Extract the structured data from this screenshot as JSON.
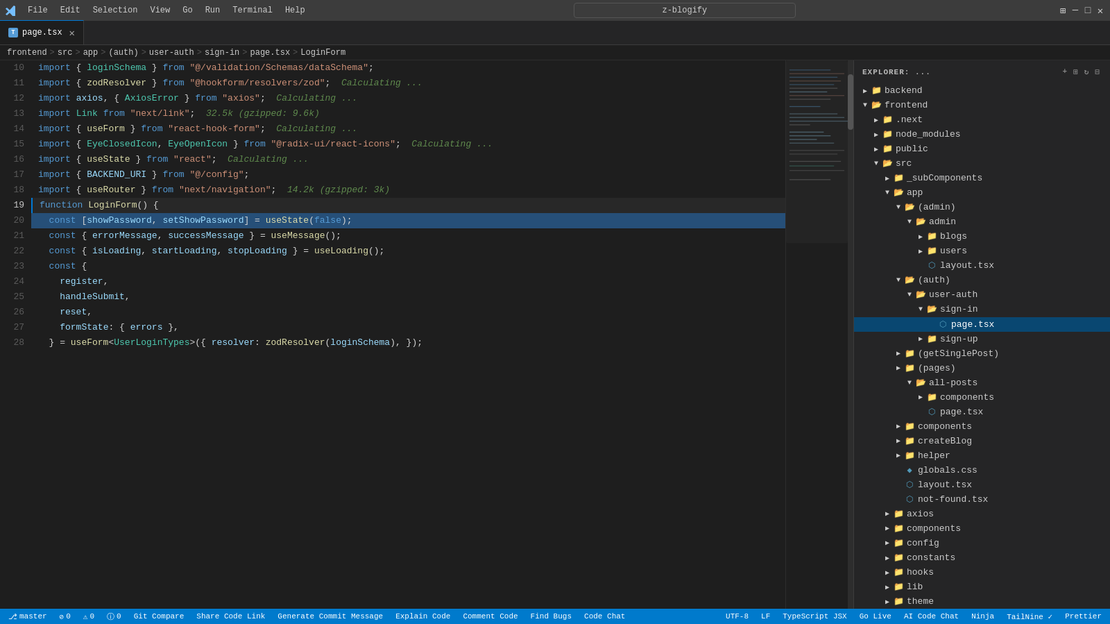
{
  "titleBar": {
    "appName": "z-blogify",
    "menuItems": [
      "File",
      "Edit",
      "Selection",
      "View",
      "Go",
      "Run",
      "Terminal",
      "Help"
    ]
  },
  "tabs": [
    {
      "id": "page-tsx",
      "label": "page.tsx",
      "active": true,
      "icon": "tsx"
    }
  ],
  "breadcrumb": {
    "items": [
      "frontend",
      "src",
      "app",
      "(auth)",
      "user-auth",
      "sign-in",
      "page.tsx",
      "LoginForm"
    ]
  },
  "editor": {
    "lines": [
      {
        "num": 10,
        "content": "import { loginSchema } from \"@/validation/Schemas/dataSchema\";"
      },
      {
        "num": 11,
        "content": "import { zodResolver } from \"@hookform/resolvers/zod\";  Calculating ..."
      },
      {
        "num": 12,
        "content": "import axios, { AxiosError } from \"axios\";  Calculating ..."
      },
      {
        "num": 13,
        "content": "import Link from \"next/link\";  32.5k (gzipped: 9.6k)"
      },
      {
        "num": 14,
        "content": "import { useForm } from \"react-hook-form\";  Calculating ..."
      },
      {
        "num": 15,
        "content": "import { EyeClosedIcon, EyeOpenIcon } from \"@radix-ui/react-icons\";  Calculating ..."
      },
      {
        "num": 16,
        "content": "import { useState } from \"react\";  Calculating ..."
      },
      {
        "num": 17,
        "content": "import { BACKEND_URI } from \"@/config\";"
      },
      {
        "num": 18,
        "content": "import { useRouter } from \"next/navigation\";  14.2k (gzipped: 3k)"
      },
      {
        "num": 19,
        "content": "function LoginForm() {"
      },
      {
        "num": 20,
        "content": "  const [showPassword, setShowPassword] = useState(false);"
      },
      {
        "num": 21,
        "content": "  const { errorMessage, successMessage } = useMessage();"
      },
      {
        "num": 22,
        "content": "  const { isLoading, startLoading, stopLoading } = useLoading();"
      },
      {
        "num": 23,
        "content": "  const {"
      },
      {
        "num": 24,
        "content": "    register,"
      },
      {
        "num": 25,
        "content": "    handleSubmit,"
      },
      {
        "num": 26,
        "content": "    reset,"
      },
      {
        "num": 27,
        "content": "    formState: { errors },"
      },
      {
        "num": 28,
        "content": "  } = useForm<UserLoginTypes>({ resolver: zodResolver(loginSchema) });"
      }
    ]
  },
  "sidebar": {
    "title": "EXPLORER: ...",
    "tree": [
      {
        "id": "backend",
        "label": "backend",
        "type": "folder",
        "depth": 0,
        "expanded": false
      },
      {
        "id": "frontend",
        "label": "frontend",
        "type": "folder",
        "depth": 0,
        "expanded": true
      },
      {
        "id": "next",
        "label": ".next",
        "type": "folder",
        "depth": 1,
        "expanded": false
      },
      {
        "id": "node_modules",
        "label": "node_modules",
        "type": "folder",
        "depth": 1,
        "expanded": false
      },
      {
        "id": "public",
        "label": "public",
        "type": "folder",
        "depth": 1,
        "expanded": false
      },
      {
        "id": "src",
        "label": "src",
        "type": "folder",
        "depth": 1,
        "expanded": true
      },
      {
        "id": "_subcomponents",
        "label": "_subComponents",
        "type": "folder",
        "depth": 2,
        "expanded": false
      },
      {
        "id": "app",
        "label": "app",
        "type": "folder",
        "depth": 2,
        "expanded": true
      },
      {
        "id": "admin",
        "label": "(admin)",
        "type": "folder",
        "depth": 3,
        "expanded": true
      },
      {
        "id": "admin2",
        "label": "admin",
        "type": "folder",
        "depth": 4,
        "expanded": true
      },
      {
        "id": "blogs",
        "label": "blogs",
        "type": "folder",
        "depth": 5,
        "expanded": false
      },
      {
        "id": "users",
        "label": "users",
        "type": "folder",
        "depth": 5,
        "expanded": false
      },
      {
        "id": "layout-tsx",
        "label": "layout.tsx",
        "type": "file-tsx",
        "depth": 5
      },
      {
        "id": "auth",
        "label": "(auth)",
        "type": "folder",
        "depth": 3,
        "expanded": true
      },
      {
        "id": "user-auth",
        "label": "user-auth",
        "type": "folder",
        "depth": 4,
        "expanded": true
      },
      {
        "id": "sign-in",
        "label": "sign-in",
        "type": "folder",
        "depth": 5,
        "expanded": true
      },
      {
        "id": "page-tsx-active",
        "label": "page.tsx",
        "type": "file-tsx",
        "depth": 6,
        "active": true
      },
      {
        "id": "sign-up",
        "label": "sign-up",
        "type": "folder",
        "depth": 5,
        "expanded": false
      },
      {
        "id": "getSinglePost",
        "label": "(getSinglePost)",
        "type": "folder",
        "depth": 3,
        "expanded": false
      },
      {
        "id": "pages",
        "label": "(pages)",
        "type": "folder",
        "depth": 3,
        "expanded": false
      },
      {
        "id": "all-posts",
        "label": "all-posts",
        "type": "folder",
        "depth": 4,
        "expanded": true
      },
      {
        "id": "components",
        "label": "components",
        "type": "folder",
        "depth": 5,
        "expanded": false
      },
      {
        "id": "page-tsx-2",
        "label": "page.tsx",
        "type": "file-tsx",
        "depth": 5
      },
      {
        "id": "components2",
        "label": "components",
        "type": "folder",
        "depth": 3,
        "expanded": false
      },
      {
        "id": "createBlog",
        "label": "createBlog",
        "type": "folder",
        "depth": 3,
        "expanded": false
      },
      {
        "id": "helper",
        "label": "helper",
        "type": "folder",
        "depth": 3,
        "expanded": false
      },
      {
        "id": "globals-css",
        "label": "globals.css",
        "type": "file-css",
        "depth": 3
      },
      {
        "id": "layout-tsx2",
        "label": "layout.tsx",
        "type": "file-tsx",
        "depth": 3
      },
      {
        "id": "not-found-tsx",
        "label": "not-found.tsx",
        "type": "file-tsx",
        "depth": 3
      },
      {
        "id": "axios2",
        "label": "axios",
        "type": "folder",
        "depth": 2,
        "expanded": false
      },
      {
        "id": "components3",
        "label": "components",
        "type": "folder",
        "depth": 2,
        "expanded": false
      },
      {
        "id": "config",
        "label": "config",
        "type": "folder",
        "depth": 2,
        "expanded": false
      },
      {
        "id": "constants",
        "label": "constants",
        "type": "folder",
        "depth": 2,
        "expanded": false
      },
      {
        "id": "hooks",
        "label": "hooks",
        "type": "folder",
        "depth": 2,
        "expanded": false
      },
      {
        "id": "lib",
        "label": "lib",
        "type": "folder",
        "depth": 2,
        "expanded": false
      },
      {
        "id": "theme",
        "label": "theme",
        "type": "folder",
        "depth": 2,
        "expanded": false
      }
    ]
  },
  "statusBar": {
    "left": [
      "master",
      "0 errors",
      "0 warnings",
      "0",
      "Git Compare",
      "Share Code Link",
      "Generate Commit Message",
      "Explain Code",
      "Comment Code",
      "Find Bugs",
      "Code Chat"
    ],
    "right": [
      "UTF-8",
      "LF",
      "TypeScript JSX",
      "Go Live",
      "AI Code Chat",
      "Ninja",
      "TailNine",
      "Prettier"
    ]
  }
}
